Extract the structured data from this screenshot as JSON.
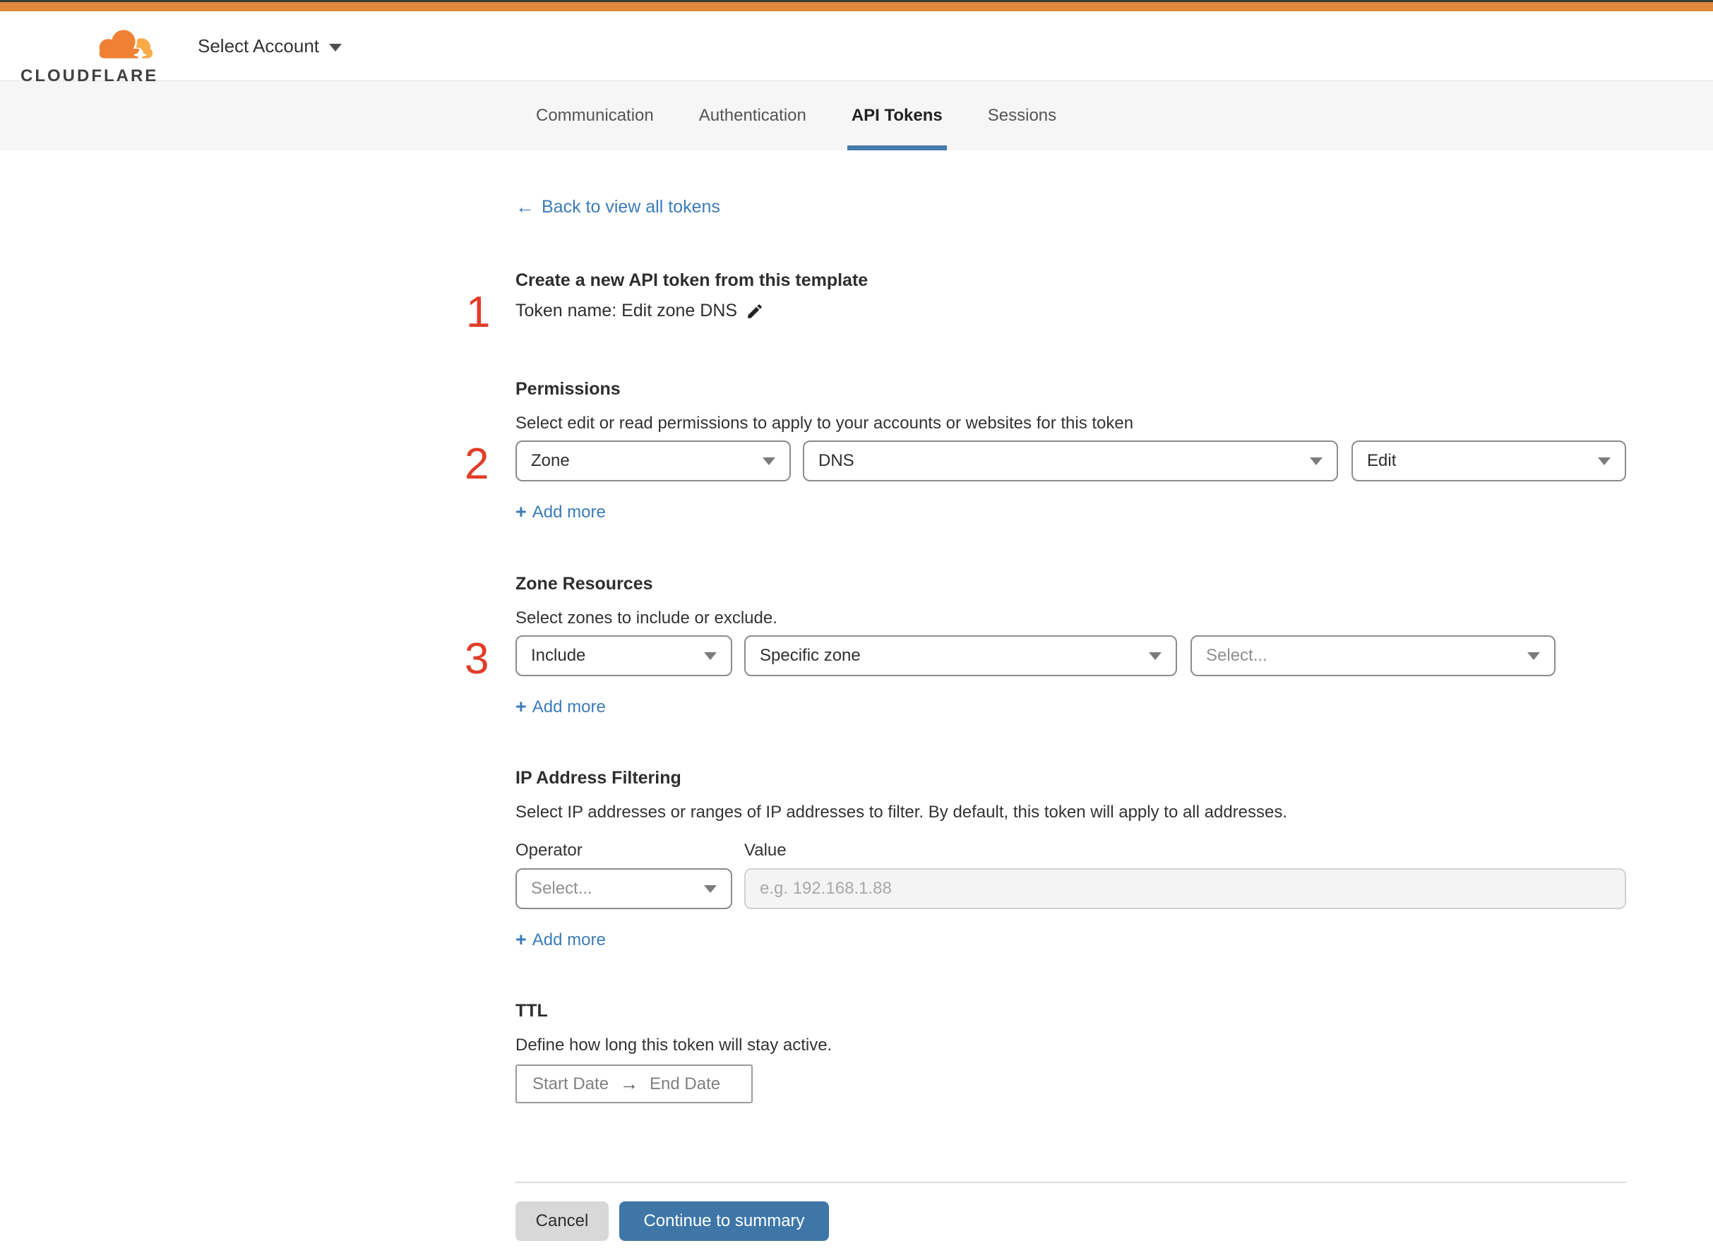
{
  "header": {
    "brand": "CLOUDFLARE",
    "account_selector": "Select Account"
  },
  "tabs": [
    {
      "label": "Communication",
      "active": false
    },
    {
      "label": "Authentication",
      "active": false
    },
    {
      "label": "API Tokens",
      "active": true
    },
    {
      "label": "Sessions",
      "active": false
    }
  ],
  "annotations": {
    "step1": "1",
    "step2": "2",
    "step3": "3"
  },
  "content": {
    "back_link": {
      "arrow": "←",
      "label": "Back to view all tokens"
    },
    "template": {
      "title": "Create a new API token from this template",
      "token_name": "Token name: Edit zone DNS"
    },
    "permissions": {
      "heading": "Permissions",
      "description": "Select edit or read permissions to apply to your accounts or websites for this token",
      "scope_value": "Zone",
      "service_value": "DNS",
      "access_value": "Edit",
      "add_more": {
        "plus": "+",
        "label": "Add more"
      }
    },
    "zone_resources": {
      "heading": "Zone Resources",
      "description": "Select zones to include or exclude.",
      "operator_value": "Include",
      "type_value": "Specific zone",
      "zone_placeholder": "Select...",
      "add_more": {
        "plus": "+",
        "label": "Add more"
      }
    },
    "ip_filtering": {
      "heading": "IP Address Filtering",
      "description": "Select IP addresses or ranges of IP addresses to filter. By default, this token will apply to all addresses.",
      "operator_label": "Operator",
      "value_label": "Value",
      "operator_placeholder": "Select...",
      "value_placeholder": "e.g. 192.168.1.88",
      "add_more": {
        "plus": "+",
        "label": "Add more"
      }
    },
    "ttl": {
      "heading": "TTL",
      "description": "Define how long this token will stay active.",
      "start_date": "Start Date",
      "arrow": "→",
      "end_date": "End Date"
    },
    "footer": {
      "cancel": "Cancel",
      "continue": "Continue to summary"
    }
  },
  "colors": {
    "top_bar_orange": "#e0883c",
    "brand_orange": "#ee8133",
    "brand_orange_light": "#f9ab49",
    "link_blue": "#3b7cb8",
    "active_tab_underline": "#447cab",
    "primary_button_blue": "#3e76a8",
    "cancel_button_gray": "#d8d8d8",
    "annotation_red": "#e23c28"
  }
}
